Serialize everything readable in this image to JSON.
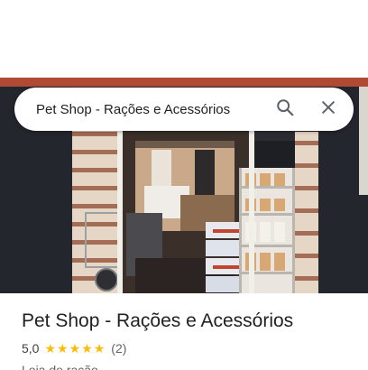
{
  "search": {
    "query": "Pet Shop - Rações e Acessórios",
    "search_icon": "search-icon",
    "close_icon": "close-icon"
  },
  "place": {
    "title": "Pet Shop - Rações e Acessórios",
    "rating": "5,0",
    "stars": 5,
    "star_color": "#fbbc04",
    "reviews": "(2)",
    "category": "Loja de ração"
  },
  "photo": {
    "description_icon": "storefront-photo"
  }
}
